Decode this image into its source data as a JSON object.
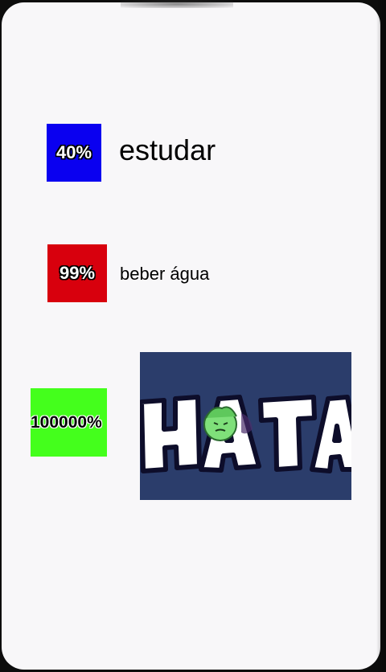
{
  "items": [
    {
      "percent": "40%",
      "label": "estudar",
      "color": "#0a00f0"
    },
    {
      "percent": "99%",
      "label": "beber água",
      "color": "#d8000d"
    },
    {
      "percent": "100000%",
      "label": "",
      "color": "#44ff1c"
    }
  ],
  "meme": {
    "text": "HATA",
    "background": "#2b3d6b"
  }
}
